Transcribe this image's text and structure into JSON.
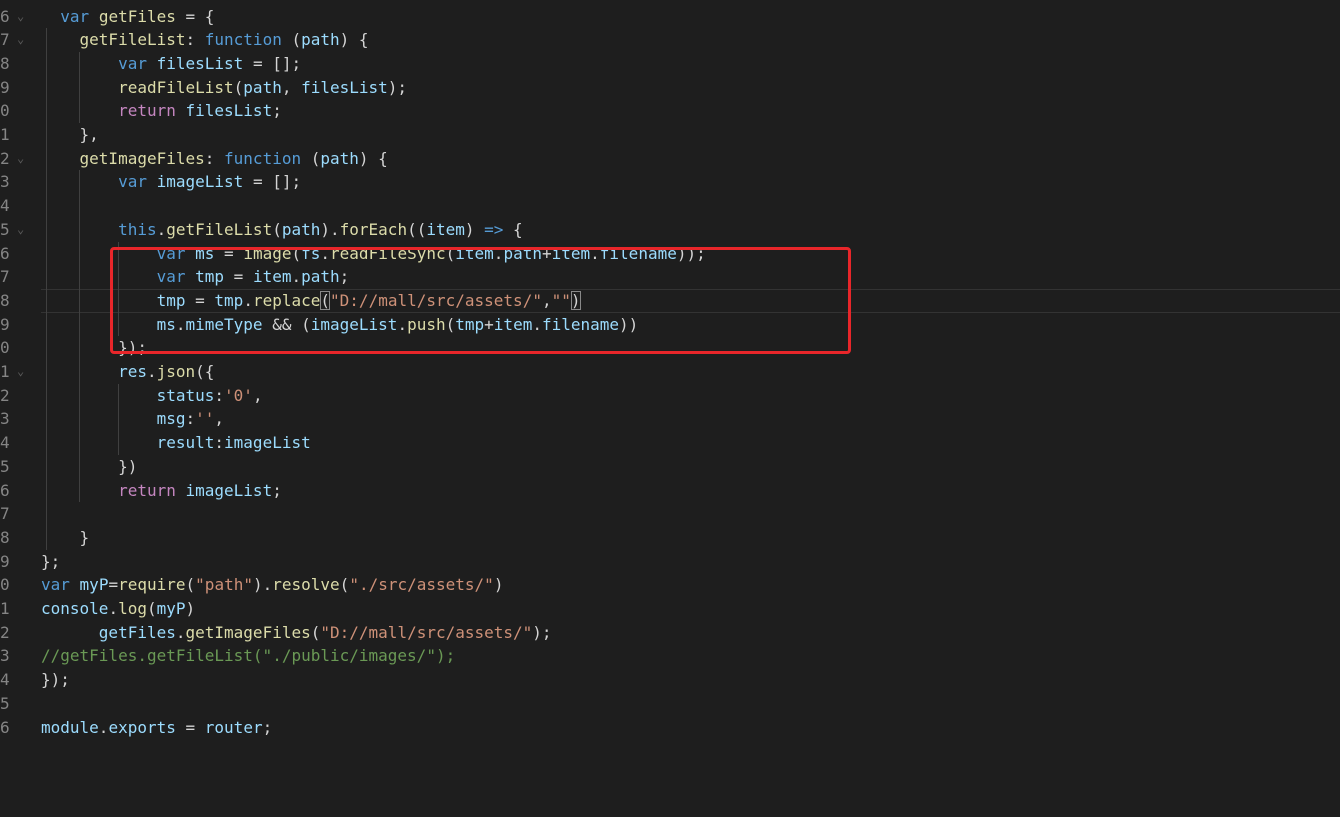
{
  "editor": {
    "lines": [
      {
        "n": "6",
        "fold": "⌄",
        "indent": 1,
        "tokens": [
          [
            "k",
            "var"
          ],
          [
            "",
            " "
          ],
          [
            "f",
            "getFiles"
          ],
          [
            "",
            " = {"
          ]
        ]
      },
      {
        "n": "7",
        "fold": "⌄",
        "indent": 2,
        "tokens": [
          [
            "f",
            "getFileList"
          ],
          [
            "",
            ": "
          ],
          [
            "k",
            "function"
          ],
          [
            "",
            " ("
          ],
          [
            "v",
            "path"
          ],
          [
            "",
            ") {"
          ]
        ]
      },
      {
        "n": "8",
        "fold": "",
        "indent": 4,
        "tokens": [
          [
            "k",
            "var"
          ],
          [
            "",
            " "
          ],
          [
            "v",
            "filesList"
          ],
          [
            "",
            " = [];"
          ]
        ]
      },
      {
        "n": "9",
        "fold": "",
        "indent": 4,
        "tokens": [
          [
            "f",
            "readFileList"
          ],
          [
            "",
            "("
          ],
          [
            "v",
            "path"
          ],
          [
            "",
            ", "
          ],
          [
            "v",
            "filesList"
          ],
          [
            "",
            ");"
          ]
        ]
      },
      {
        "n": "0",
        "fold": "",
        "indent": 4,
        "tokens": [
          [
            "c",
            "return"
          ],
          [
            "",
            " "
          ],
          [
            "v",
            "filesList"
          ],
          [
            "",
            ";"
          ]
        ]
      },
      {
        "n": "1",
        "fold": "",
        "indent": 2,
        "tokens": [
          [
            "",
            "},"
          ]
        ]
      },
      {
        "n": "2",
        "fold": "⌄",
        "indent": 2,
        "tokens": [
          [
            "f",
            "getImageFiles"
          ],
          [
            "",
            ": "
          ],
          [
            "k",
            "function"
          ],
          [
            "",
            " ("
          ],
          [
            "v",
            "path"
          ],
          [
            "",
            ") {"
          ]
        ]
      },
      {
        "n": "3",
        "fold": "",
        "indent": 4,
        "tokens": [
          [
            "k",
            "var"
          ],
          [
            "",
            " "
          ],
          [
            "v",
            "imageList"
          ],
          [
            "",
            " = [];"
          ]
        ]
      },
      {
        "n": "4",
        "fold": "",
        "indent": 0,
        "tokens": []
      },
      {
        "n": "5",
        "fold": "⌄",
        "indent": 4,
        "tokens": [
          [
            "k",
            "this"
          ],
          [
            "",
            "."
          ],
          [
            "f",
            "getFileList"
          ],
          [
            "",
            "("
          ],
          [
            "v",
            "path"
          ],
          [
            "",
            ")."
          ],
          [
            "f",
            "forEach"
          ],
          [
            "",
            "(("
          ],
          [
            "v",
            "item"
          ],
          [
            "",
            ") "
          ],
          [
            "k",
            "=>"
          ],
          [
            "",
            " {"
          ]
        ]
      },
      {
        "n": "6",
        "fold": "",
        "indent": 6,
        "tokens": [
          [
            "k",
            "var"
          ],
          [
            "",
            " "
          ],
          [
            "v",
            "ms"
          ],
          [
            "",
            " = "
          ],
          [
            "f",
            "image"
          ],
          [
            "",
            "("
          ],
          [
            "v",
            "fs"
          ],
          [
            "",
            "."
          ],
          [
            "f",
            "readFileSync"
          ],
          [
            "",
            "("
          ],
          [
            "v",
            "item"
          ],
          [
            "",
            "."
          ],
          [
            "v",
            "path"
          ],
          [
            "",
            "+"
          ],
          [
            "v",
            "item"
          ],
          [
            "",
            "."
          ],
          [
            "v",
            "filename"
          ],
          [
            "",
            "));"
          ]
        ]
      },
      {
        "n": "7",
        "fold": "",
        "indent": 6,
        "tokens": [
          [
            "k",
            "var"
          ],
          [
            "",
            " "
          ],
          [
            "v",
            "tmp"
          ],
          [
            "",
            " = "
          ],
          [
            "v",
            "item"
          ],
          [
            "",
            "."
          ],
          [
            "v",
            "path"
          ],
          [
            "",
            ";"
          ]
        ]
      },
      {
        "n": "8",
        "fold": "",
        "indent": 6,
        "tokens": [
          [
            "v",
            "tmp"
          ],
          [
            "",
            " = "
          ],
          [
            "v",
            "tmp"
          ],
          [
            "",
            "."
          ],
          [
            "f",
            "replace"
          ],
          [
            "bm",
            "("
          ],
          [
            "s",
            "\"D://mall/src/assets/\""
          ],
          [
            "",
            ","
          ],
          [
            "s",
            "\"\""
          ],
          [
            "bm",
            ")"
          ]
        ]
      },
      {
        "n": "9",
        "fold": "",
        "indent": 6,
        "tokens": [
          [
            "v",
            "ms"
          ],
          [
            "",
            "."
          ],
          [
            "v",
            "mimeType"
          ],
          [
            "",
            " && ("
          ],
          [
            "v",
            "imageList"
          ],
          [
            "",
            "."
          ],
          [
            "f",
            "push"
          ],
          [
            "",
            "("
          ],
          [
            "v",
            "tmp"
          ],
          [
            "",
            "+"
          ],
          [
            "v",
            "item"
          ],
          [
            "",
            "."
          ],
          [
            "v",
            "filename"
          ],
          [
            "",
            "))"
          ]
        ]
      },
      {
        "n": "0",
        "fold": "",
        "indent": 4,
        "tokens": [
          [
            "",
            "});"
          ]
        ]
      },
      {
        "n": "1",
        "fold": "⌄",
        "indent": 4,
        "tokens": [
          [
            "v",
            "res"
          ],
          [
            "",
            "."
          ],
          [
            "f",
            "json"
          ],
          [
            "",
            "({"
          ]
        ]
      },
      {
        "n": "2",
        "fold": "",
        "indent": 6,
        "tokens": [
          [
            "v",
            "status"
          ],
          [
            "",
            ":"
          ],
          [
            "s",
            "'0'"
          ],
          [
            "",
            ","
          ]
        ]
      },
      {
        "n": "3",
        "fold": "",
        "indent": 6,
        "tokens": [
          [
            "v",
            "msg"
          ],
          [
            "",
            ":"
          ],
          [
            "s",
            "''"
          ],
          [
            "",
            ","
          ]
        ]
      },
      {
        "n": "4",
        "fold": "",
        "indent": 6,
        "tokens": [
          [
            "v",
            "result"
          ],
          [
            "",
            ":"
          ],
          [
            "v",
            "imageList"
          ]
        ]
      },
      {
        "n": "5",
        "fold": "",
        "indent": 4,
        "tokens": [
          [
            "",
            "})"
          ]
        ]
      },
      {
        "n": "6",
        "fold": "",
        "indent": 4,
        "tokens": [
          [
            "c",
            "return"
          ],
          [
            "",
            " "
          ],
          [
            "v",
            "imageList"
          ],
          [
            "",
            ";"
          ]
        ]
      },
      {
        "n": "7",
        "fold": "",
        "indent": 0,
        "tokens": []
      },
      {
        "n": "8",
        "fold": "",
        "indent": 2,
        "tokens": [
          [
            "",
            "}"
          ]
        ]
      },
      {
        "n": "9",
        "fold": "",
        "indent": 0,
        "tokens": [
          [
            "",
            "};"
          ]
        ]
      },
      {
        "n": "0",
        "fold": "",
        "indent": 0,
        "tokens": [
          [
            "k",
            "var"
          ],
          [
            "",
            " "
          ],
          [
            "v",
            "myP"
          ],
          [
            "",
            "="
          ],
          [
            "f",
            "require"
          ],
          [
            "",
            "("
          ],
          [
            "s",
            "\"path\""
          ],
          [
            "",
            ")."
          ],
          [
            "f",
            "resolve"
          ],
          [
            "",
            "("
          ],
          [
            "s",
            "\"./src/assets/\""
          ],
          [
            "",
            ")"
          ]
        ]
      },
      {
        "n": "1",
        "fold": "",
        "indent": 0,
        "tokens": [
          [
            "v",
            "console"
          ],
          [
            "",
            "."
          ],
          [
            "f",
            "log"
          ],
          [
            "",
            "("
          ],
          [
            "v",
            "myP"
          ],
          [
            "",
            ")"
          ]
        ]
      },
      {
        "n": "2",
        "fold": "",
        "indent": 3,
        "tokens": [
          [
            "v",
            "getFiles"
          ],
          [
            "",
            "."
          ],
          [
            "f",
            "getImageFiles"
          ],
          [
            "",
            "("
          ],
          [
            "s",
            "\"D://mall/src/assets/\""
          ],
          [
            "",
            ");"
          ]
        ]
      },
      {
        "n": "3",
        "fold": "",
        "indent": 0,
        "tokens": [
          [
            "m",
            "//getFiles.getFileList(\"./public/images/\");"
          ]
        ]
      },
      {
        "n": "4",
        "fold": "",
        "indent": 0,
        "tokens": [
          [
            "",
            "});"
          ]
        ]
      },
      {
        "n": "5",
        "fold": "",
        "indent": 0,
        "tokens": []
      },
      {
        "n": "6",
        "fold": "",
        "indent": 0,
        "tokens": [
          [
            "v",
            "module"
          ],
          [
            "",
            "."
          ],
          [
            "v",
            "exports"
          ],
          [
            "",
            " = "
          ],
          [
            "v",
            "router"
          ],
          [
            "",
            ";"
          ]
        ]
      }
    ],
    "current_line_index": 12
  },
  "colors": {
    "background": "#1e1e1e",
    "keyword": "#569cd6",
    "control": "#c586c0",
    "function": "#dcdcaa",
    "variable": "#9cdcfe",
    "string": "#ce9178",
    "comment": "#6a9955",
    "highlight_box": "#e8262a"
  }
}
